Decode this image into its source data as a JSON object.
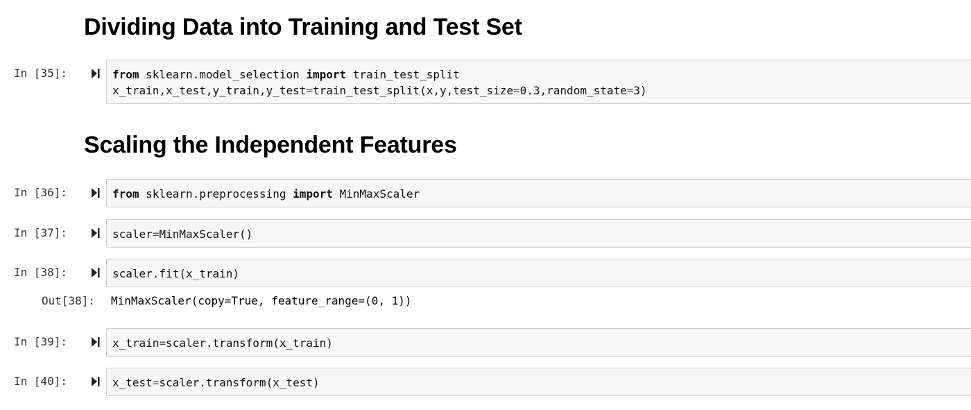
{
  "headings": [
    "Dividing Data into Training and Test Set",
    "Scaling the Independent Features"
  ],
  "cells": [
    {
      "prompt": "In [35]:",
      "lines": [
        [
          {
            "t": "from",
            "k": "kw"
          },
          {
            "t": " sklearn.model_selection "
          },
          {
            "t": "import",
            "k": "kw"
          },
          {
            "t": " train_test_split"
          }
        ],
        [
          {
            "t": "x_train,x_test,y_train,y_test"
          },
          {
            "t": "=",
            "k": "op"
          },
          {
            "t": "train_test_split(x,y,test_size"
          },
          {
            "t": "=",
            "k": "op"
          },
          {
            "t": "0.3,random_state"
          },
          {
            "t": "=",
            "k": "op"
          },
          {
            "t": "3)"
          }
        ]
      ]
    },
    {
      "prompt": "In [36]:",
      "lines": [
        [
          {
            "t": "from",
            "k": "kw"
          },
          {
            "t": " sklearn.preprocessing "
          },
          {
            "t": "import",
            "k": "kw"
          },
          {
            "t": " MinMaxScaler"
          }
        ]
      ]
    },
    {
      "prompt": "In [37]:",
      "lines": [
        [
          {
            "t": "scaler"
          },
          {
            "t": "=",
            "k": "op"
          },
          {
            "t": "MinMaxScaler()"
          }
        ]
      ]
    },
    {
      "prompt": "In [38]:",
      "lines": [
        [
          {
            "t": "scaler.fit(x_train)"
          }
        ]
      ],
      "out_prompt": "Out[38]:",
      "output": "MinMaxScaler(copy=True, feature_range=(0, 1))"
    },
    {
      "prompt": "In [39]:",
      "lines": [
        [
          {
            "t": "x_train"
          },
          {
            "t": "=",
            "k": "op"
          },
          {
            "t": "scaler.transform(x_train)"
          }
        ]
      ]
    },
    {
      "prompt": "In [40]:",
      "lines": [
        [
          {
            "t": "x_test"
          },
          {
            "t": "=",
            "k": "op"
          },
          {
            "t": "scaler.transform(x_test)"
          }
        ]
      ]
    }
  ]
}
